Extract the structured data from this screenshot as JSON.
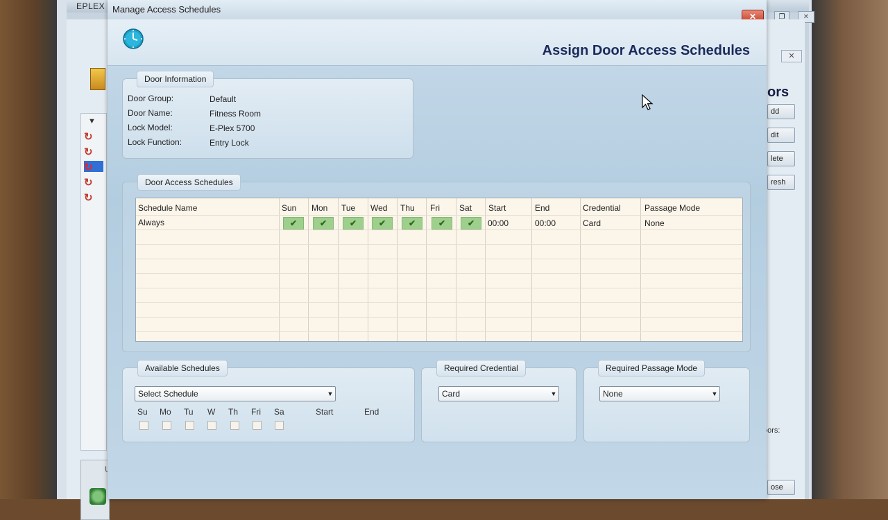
{
  "background_app": {
    "title": "EPLEX S",
    "heading": "ors",
    "buttons": [
      "dd",
      "dit",
      "lete",
      "resh"
    ],
    "doors_label": "oors:",
    "close_label": "ose",
    "partial_label": "U"
  },
  "dialog": {
    "title": "Manage Access Schedules",
    "heading": "Assign Door Access Schedules",
    "close_icon": "close-x-icon",
    "clock_icon": "clock-icon"
  },
  "door_info": {
    "title": "Door Information",
    "fields": [
      {
        "label": "Door Group:",
        "value": "Default"
      },
      {
        "label": "Door Name:",
        "value": "Fitness Room"
      },
      {
        "label": "Lock Model:",
        "value": "E-Plex 5700"
      },
      {
        "label": "Lock Function:",
        "value": "Entry Lock"
      }
    ]
  },
  "schedules": {
    "title": "Door Access Schedules",
    "columns": [
      "Schedule Name",
      "Sun",
      "Mon",
      "Tue",
      "Wed",
      "Thu",
      "Fri",
      "Sat",
      "Start",
      "End",
      "Credential",
      "Passage Mode"
    ],
    "rows": [
      {
        "name": "Always",
        "days": [
          true,
          true,
          true,
          true,
          true,
          true,
          true
        ],
        "start": "00:00",
        "end": "00:00",
        "credential": "Card",
        "passage_mode": "None"
      }
    ]
  },
  "available": {
    "title": "Available Schedules",
    "select_value": "Select Schedule",
    "days": [
      "Su",
      "Mo",
      "Tu",
      "W",
      "Th",
      "Fri",
      "Sa"
    ],
    "start_label": "Start",
    "end_label": "End"
  },
  "credential": {
    "title": "Required Credential",
    "value": "Card"
  },
  "passage": {
    "title": "Required Passage Mode",
    "value": "None"
  },
  "colors": {
    "heading": "#1b2a5a",
    "close_button": "#c53a22",
    "check_green": "#9fcf8c",
    "grid_background": "#fbf5ea"
  }
}
